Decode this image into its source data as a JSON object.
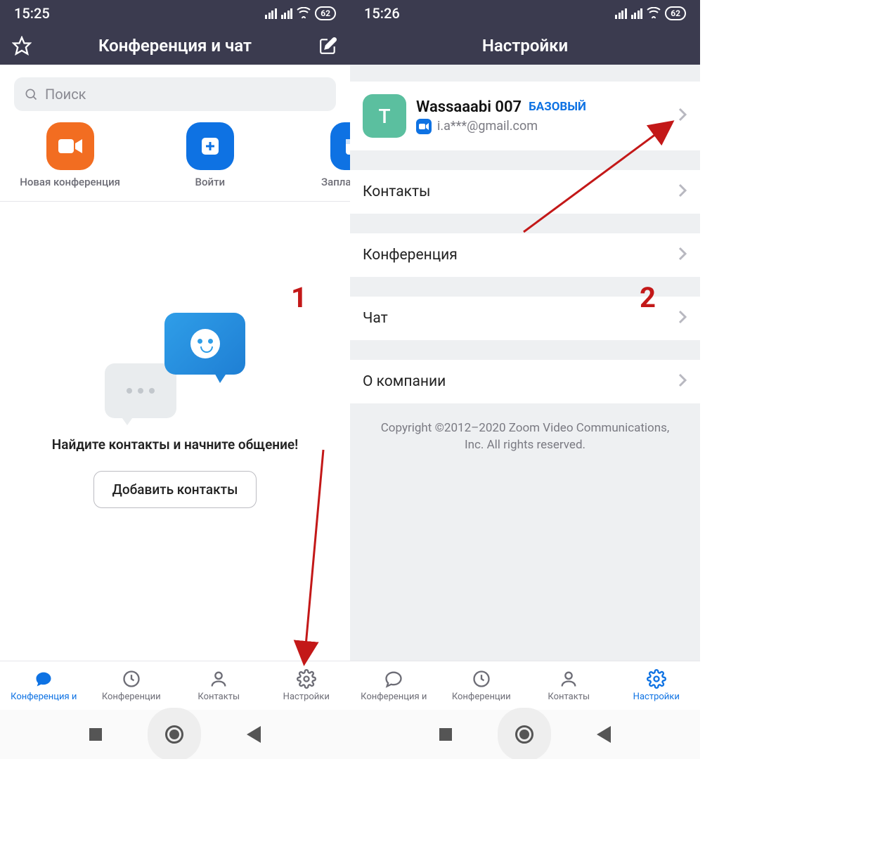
{
  "left": {
    "status": {
      "time": "15:25",
      "battery": "62"
    },
    "header": {
      "title": "Конференция и чат"
    },
    "search": {
      "placeholder": "Поиск"
    },
    "actions": {
      "new_meeting": "Новая конференция",
      "join": "Войти",
      "schedule": "Заплан"
    },
    "empty": {
      "text": "Найдите контакты и начните общение!",
      "button": "Добавить контакты"
    },
    "tabs": {
      "meet_chat": "Конференция и",
      "meetings": "Конференции",
      "contacts": "Контакты",
      "settings": "Настройки"
    },
    "annotation_number": "1"
  },
  "right": {
    "status": {
      "time": "15:26",
      "battery": "62"
    },
    "header": {
      "title": "Настройки"
    },
    "user": {
      "initial": "T",
      "name": "Wassaaabi 007",
      "plan": "БАЗОВЫЙ",
      "email": "i.a***@gmail.com"
    },
    "items": {
      "contacts": "Контакты",
      "conference": "Конференция",
      "chat": "Чат",
      "about": "О компании"
    },
    "copyright": "Copyright ©2012–2020 Zoom Video Communications, Inc. All rights reserved.",
    "tabs": {
      "meet_chat": "Конференция и",
      "meetings": "Конференции",
      "contacts": "Контакты",
      "settings": "Настройки"
    },
    "annotation_number": "2"
  }
}
